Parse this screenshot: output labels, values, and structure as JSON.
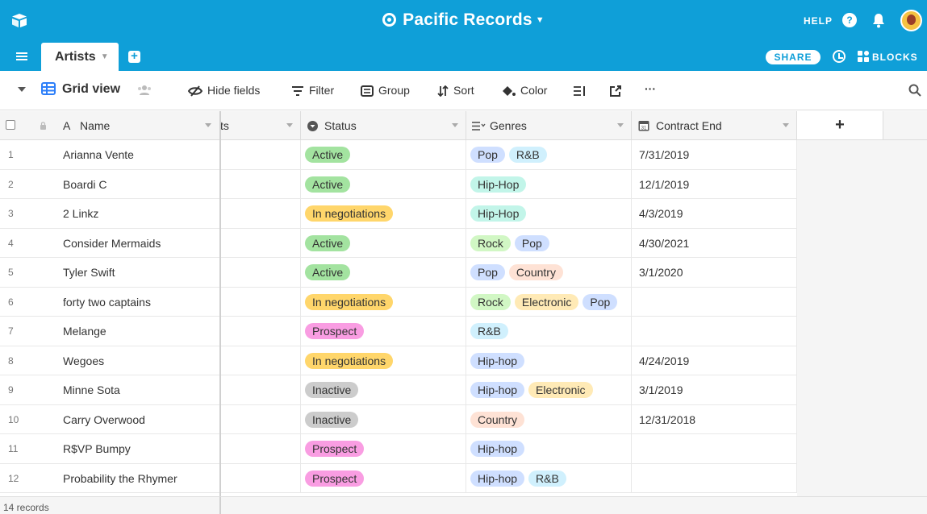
{
  "header": {
    "base_name": "Pacific Records",
    "help_label": "HELP"
  },
  "tabs": {
    "active_tab": "Artists",
    "share_label": "SHARE",
    "blocks_label": "BLOCKS"
  },
  "toolbar": {
    "view_name": "Grid view",
    "hide_fields": "Hide fields",
    "filter": "Filter",
    "group": "Group",
    "sort": "Sort",
    "color": "Color",
    "more": "···"
  },
  "columns": {
    "name": "Name",
    "truncated": "ts",
    "status": "Status",
    "genres": "Genres",
    "contract_end": "Contract End",
    "add": "+"
  },
  "colors": {
    "brand": "#0f9fd8",
    "status_active": "#a3e3a0",
    "status_negotiations": "#ffd66b",
    "status_prospect": "#f99de2",
    "status_inactive": "#cccccc",
    "genre_pop": "#cfdfff",
    "genre_rnb": "#d0f0fd",
    "genre_hiphop": "#c2f5e9",
    "genre_rock": "#d1f7c4",
    "genre_country": "#fee2d5",
    "genre_electronic": "#ffeab6"
  },
  "rows": [
    {
      "num": "1",
      "name": "Arianna Vente",
      "status": "Active",
      "status_color": "#a3e3a0",
      "genres": [
        {
          "label": "Pop",
          "color": "#cfdfff"
        },
        {
          "label": "R&B",
          "color": "#d0f0fd"
        }
      ],
      "contract_end": "7/31/2019"
    },
    {
      "num": "2",
      "name": "Boardi C",
      "status": "Active",
      "status_color": "#a3e3a0",
      "genres": [
        {
          "label": "Hip-Hop",
          "color": "#c2f5e9"
        }
      ],
      "contract_end": "12/1/2019"
    },
    {
      "num": "3",
      "name": "2 Linkz",
      "status": "In negotiations",
      "status_color": "#ffd66b",
      "genres": [
        {
          "label": "Hip-Hop",
          "color": "#c2f5e9"
        }
      ],
      "contract_end": "4/3/2019"
    },
    {
      "num": "4",
      "name": "Consider Mermaids",
      "status": "Active",
      "status_color": "#a3e3a0",
      "genres": [
        {
          "label": "Rock",
          "color": "#d1f7c4"
        },
        {
          "label": "Pop",
          "color": "#cfdfff"
        }
      ],
      "contract_end": "4/30/2021"
    },
    {
      "num": "5",
      "name": "Tyler Swift",
      "status": "Active",
      "status_color": "#a3e3a0",
      "genres": [
        {
          "label": "Pop",
          "color": "#cfdfff"
        },
        {
          "label": "Country",
          "color": "#fee2d5"
        }
      ],
      "contract_end": "3/1/2020"
    },
    {
      "num": "6",
      "name": "forty two captains",
      "status": "In negotiations",
      "status_color": "#ffd66b",
      "genres": [
        {
          "label": "Rock",
          "color": "#d1f7c4"
        },
        {
          "label": "Electronic",
          "color": "#ffeab6"
        },
        {
          "label": "Pop",
          "color": "#cfdfff"
        }
      ],
      "contract_end": ""
    },
    {
      "num": "7",
      "name": "Melange",
      "status": "Prospect",
      "status_color": "#f99de2",
      "genres": [
        {
          "label": "R&B",
          "color": "#d0f0fd"
        }
      ],
      "contract_end": ""
    },
    {
      "num": "8",
      "name": "Wegoes",
      "status": "In negotiations",
      "status_color": "#ffd66b",
      "genres": [
        {
          "label": "Hip-hop",
          "color": "#cfdfff"
        }
      ],
      "contract_end": "4/24/2019"
    },
    {
      "num": "9",
      "name": "Minne Sota",
      "status": "Inactive",
      "status_color": "#cccccc",
      "genres": [
        {
          "label": "Hip-hop",
          "color": "#cfdfff"
        },
        {
          "label": "Electronic",
          "color": "#ffeab6"
        }
      ],
      "contract_end": "3/1/2019"
    },
    {
      "num": "10",
      "name": "Carry Overwood",
      "status": "Inactive",
      "status_color": "#cccccc",
      "genres": [
        {
          "label": "Country",
          "color": "#fee2d5"
        }
      ],
      "contract_end": "12/31/2018"
    },
    {
      "num": "11",
      "name": "R$VP Bumpy",
      "status": "Prospect",
      "status_color": "#f99de2",
      "genres": [
        {
          "label": "Hip-hop",
          "color": "#cfdfff"
        }
      ],
      "contract_end": ""
    },
    {
      "num": "12",
      "name": "Probability the Rhymer",
      "status": "Prospect",
      "status_color": "#f99de2",
      "genres": [
        {
          "label": "Hip-hop",
          "color": "#cfdfff"
        },
        {
          "label": "R&B",
          "color": "#d0f0fd"
        }
      ],
      "contract_end": ""
    }
  ],
  "footer": {
    "record_count": "14 records"
  }
}
